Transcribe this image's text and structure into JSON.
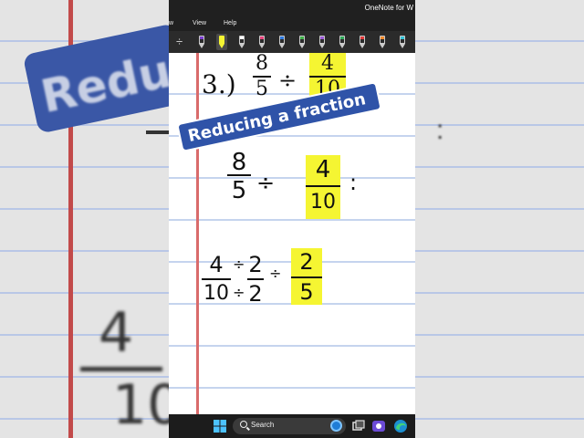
{
  "app": {
    "window_title": "OneNote for W"
  },
  "menu": [
    "View",
    "Help"
  ],
  "menu_partial": "w",
  "toolbar": {
    "divide_symbol": "÷",
    "pens": [
      {
        "name": "pen-purple",
        "band": "#7b3fd0"
      },
      {
        "name": "highlighter-yellow",
        "band": "#f5f532",
        "selected": true
      },
      {
        "name": "pen-white",
        "band": "#ffffff"
      },
      {
        "name": "pen-pink",
        "band": "#e8447c"
      },
      {
        "name": "pen-blue",
        "band": "#2d79e0"
      },
      {
        "name": "pen-green",
        "band": "#3fb24a"
      },
      {
        "name": "pen-purple-2",
        "band": "#9b59d6"
      },
      {
        "name": "pen-green-2",
        "band": "#2faa5a"
      },
      {
        "name": "pen-red",
        "band": "#e03a3a"
      },
      {
        "name": "pen-orange",
        "band": "#f08a2c"
      },
      {
        "name": "pen-cyan",
        "band": "#33c2d6"
      }
    ]
  },
  "note": {
    "problem_number": "3.)",
    "problem": {
      "a_num": "8",
      "a_den": "5",
      "op": "÷",
      "b_num": "4",
      "b_den": "10"
    },
    "step1": {
      "a_num": "8",
      "a_den": "5",
      "op": "÷",
      "b_num": "4",
      "b_den": "10",
      "tail": ":"
    },
    "step2": {
      "n1": "4",
      "op_top": "÷",
      "n2": "2",
      "d1": "10",
      "op_bot": "÷",
      "d2": "2",
      "eq": "÷",
      "r_num": "2",
      "r_den": "5"
    }
  },
  "overlay_title": "Reducing a fraction",
  "background": {
    "chip_text": "Reduc"
  },
  "taskbar": {
    "search_label": "Search"
  },
  "colors": {
    "highlight": "#f5f532",
    "pill": "#2f53a8",
    "margin": "#d96b6b"
  }
}
